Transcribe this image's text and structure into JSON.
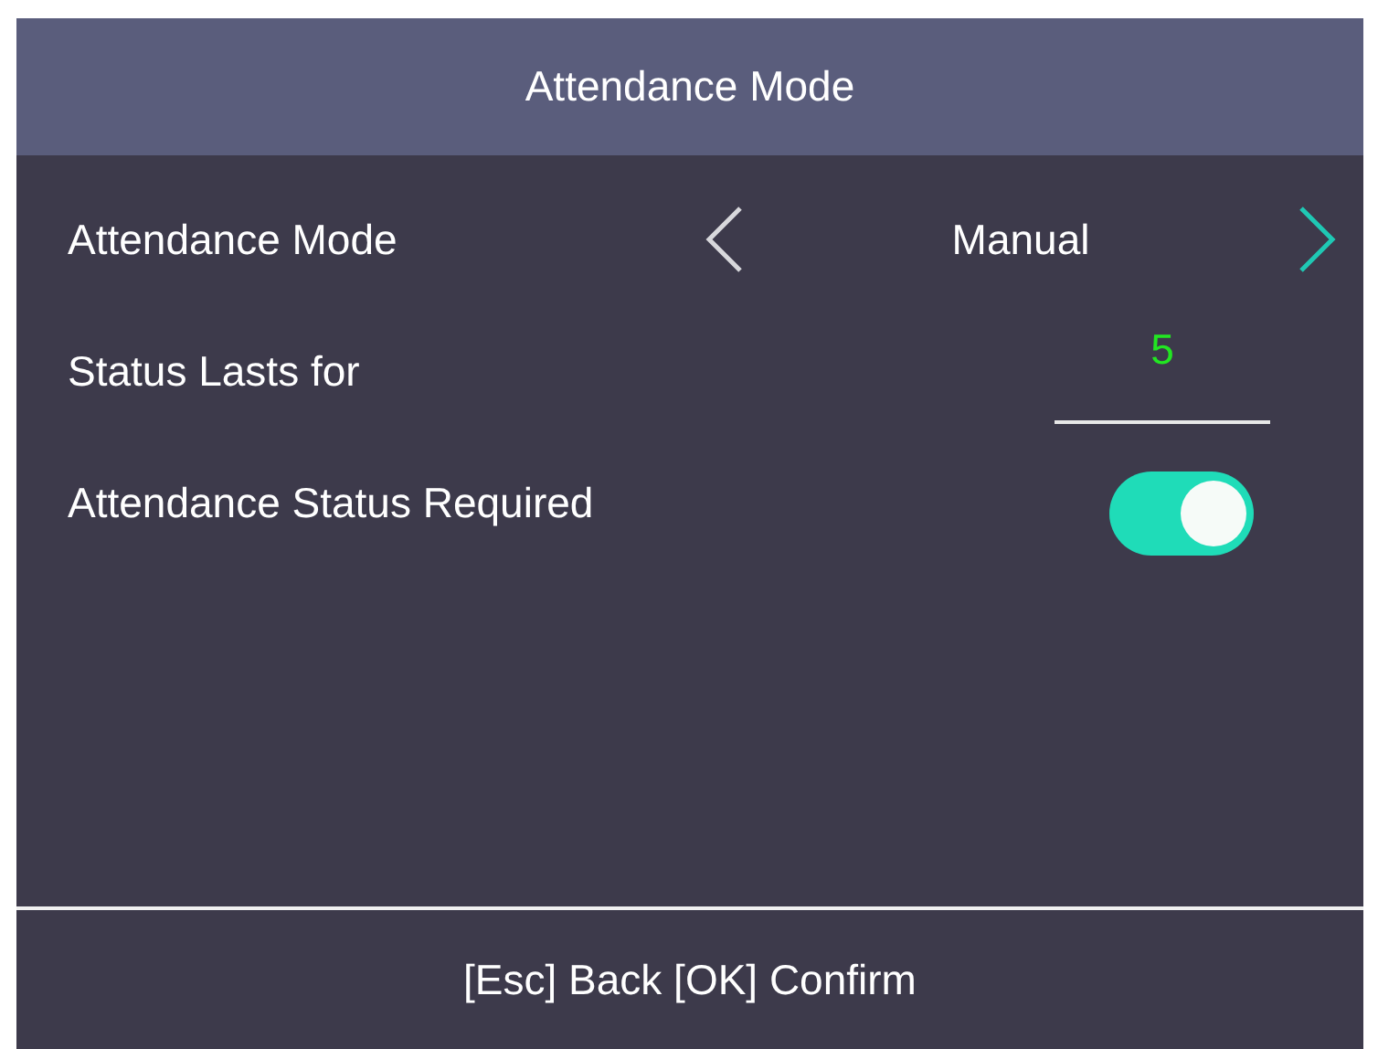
{
  "title": "Attendance Mode",
  "rows": [
    {
      "kind": "selector",
      "label": "Attendance Mode",
      "value": "Manual"
    },
    {
      "kind": "input",
      "label": "Status Lasts for",
      "value": "5"
    },
    {
      "kind": "toggle",
      "label": "Attendance Status Required",
      "on": true
    }
  ],
  "footer": "[Esc] Back [OK] Confirm"
}
